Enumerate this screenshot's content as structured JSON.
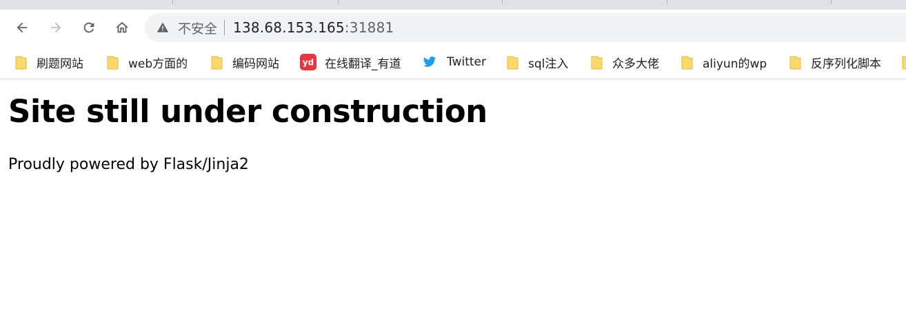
{
  "toolbar": {
    "security_label": "不安全",
    "url_host": "138.68.153.165",
    "url_port": ":31881"
  },
  "bookmarks": [
    {
      "label": "刷题网站",
      "icon": "folder-icon"
    },
    {
      "label": "web方面的",
      "icon": "folder-icon"
    },
    {
      "label": "编码网站",
      "icon": "folder-icon"
    },
    {
      "label": "在线翻译_有道",
      "icon": "youdao-icon"
    },
    {
      "label": "Twitter",
      "icon": "twitter-icon"
    },
    {
      "label": "sql注入",
      "icon": "folder-icon"
    },
    {
      "label": "众多大佬",
      "icon": "folder-icon"
    },
    {
      "label": "aliyun的wp",
      "icon": "folder-icon"
    },
    {
      "label": "反序列化脚本",
      "icon": "folder-icon"
    }
  ],
  "page": {
    "heading": "Site still under construction",
    "subtitle": "Proudly powered by Flask/Jinja2"
  },
  "colors": {
    "folder": "#fbd96b",
    "youdao": "#e8363e",
    "twitter": "#1d9bf0"
  }
}
